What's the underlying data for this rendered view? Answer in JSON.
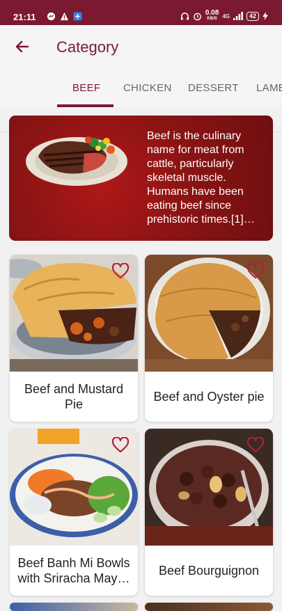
{
  "status_bar": {
    "time": "21:11",
    "net_speed_value": "0.08",
    "net_speed_unit": "KB/S",
    "network": "4G",
    "battery": "42"
  },
  "app_bar": {
    "title": "Category"
  },
  "tabs": [
    {
      "label": "BEEF",
      "active": true
    },
    {
      "label": "CHICKEN",
      "active": false
    },
    {
      "label": "DESSERT",
      "active": false
    },
    {
      "label": "LAMB",
      "active": false
    }
  ],
  "banner": {
    "description": "Beef is the culinary name for meat from cattle, particularly skeletal muscle. Humans have been eating beef since prehistoric times.[1]…"
  },
  "meals": [
    {
      "name": "Beef and Mustard Pie",
      "favorite_icon": "heart-outline-icon"
    },
    {
      "name": "Beef and Oyster pie",
      "favorite_icon": "heart-outline-icon"
    },
    {
      "name": "Beef Banh Mi Bowls with Sriracha May…",
      "favorite_icon": "heart-outline-icon"
    },
    {
      "name": "Beef Bourguignon",
      "favorite_icon": "heart-outline-icon"
    }
  ],
  "colors": {
    "accent": "#7a1930",
    "background": "#f1f1f1",
    "banner": "#8b1414"
  }
}
